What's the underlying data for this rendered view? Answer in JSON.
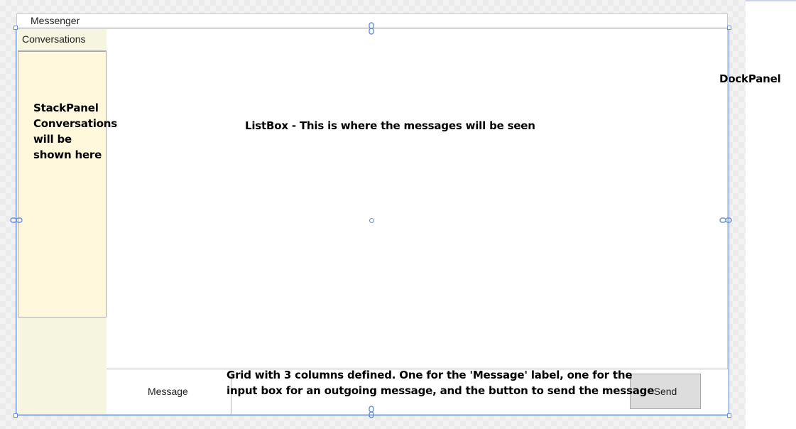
{
  "window": {
    "title": "Messenger"
  },
  "sidebar": {
    "header": "Conversations",
    "note": "StackPanel Conversations will be shown here"
  },
  "listbox": {
    "note": "ListBox - This is where the messages will be seen"
  },
  "dockpanel": {
    "note": "DockPanel"
  },
  "grid": {
    "note_line1": "Grid with 3 columns defined. One for the 'Message' label, one for the",
    "note_line2": "input box for an outgoing message, and the button to send the message",
    "message_label": "Message",
    "send_label": "Send"
  },
  "colors": {
    "selection": "#6a8fd6",
    "sidebar_bg": "#f5f5e0",
    "stackpanel_bg": "#fff8dc",
    "send_bg": "#dddddd"
  },
  "icons": {
    "anchor": "chain-link-icon"
  }
}
